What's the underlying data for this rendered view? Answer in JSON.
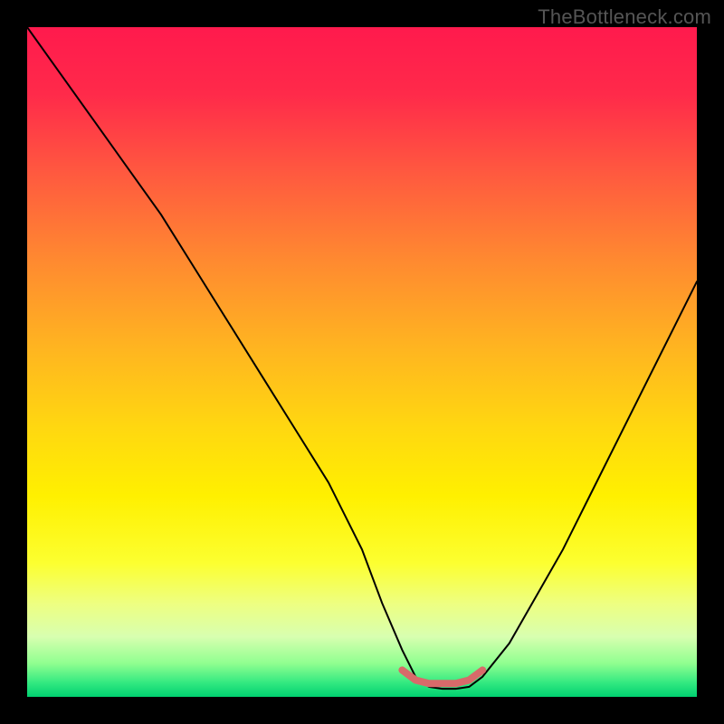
{
  "watermark": "TheBottleneck.com",
  "chart_data": {
    "type": "line",
    "title": "",
    "xlabel": "",
    "ylabel": "",
    "xlim": [
      0,
      100
    ],
    "ylim": [
      0,
      100
    ],
    "series": [
      {
        "name": "bottleneck-curve",
        "x": [
          0,
          5,
          10,
          15,
          20,
          25,
          30,
          35,
          40,
          45,
          50,
          53,
          56,
          58,
          60,
          62,
          64,
          66,
          68,
          72,
          76,
          80,
          84,
          88,
          92,
          96,
          100
        ],
        "y": [
          100,
          93,
          86,
          79,
          72,
          64,
          56,
          48,
          40,
          32,
          22,
          14,
          7,
          3,
          1.5,
          1.2,
          1.2,
          1.5,
          3,
          8,
          15,
          22,
          30,
          38,
          46,
          54,
          62
        ]
      },
      {
        "name": "optimal-range-marker",
        "x": [
          56,
          58,
          60,
          62,
          64,
          66,
          68
        ],
        "y": [
          4,
          2.5,
          2,
          2,
          2,
          2.5,
          4
        ]
      }
    ],
    "gradient_stops": [
      {
        "pos": 0.0,
        "color": "#ff1a4d"
      },
      {
        "pos": 0.5,
        "color": "#ffb520"
      },
      {
        "pos": 0.8,
        "color": "#fcff30"
      },
      {
        "pos": 1.0,
        "color": "#00d070"
      }
    ]
  }
}
